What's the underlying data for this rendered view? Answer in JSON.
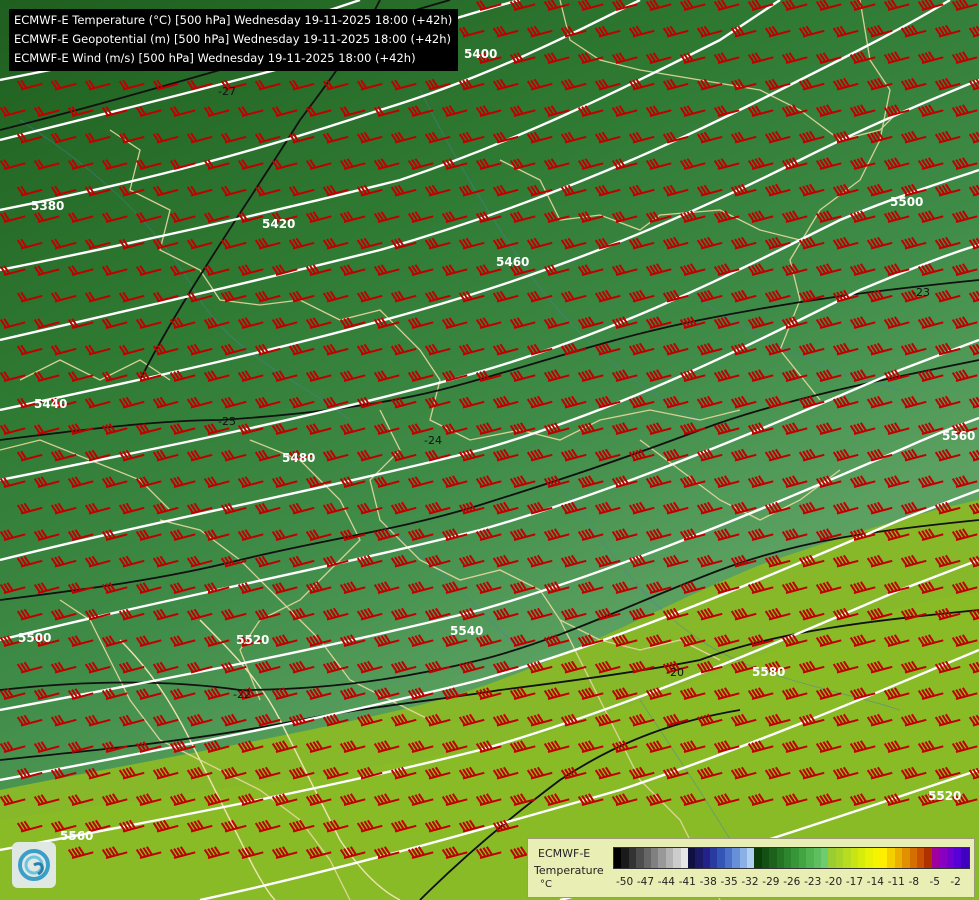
{
  "titles": [
    "ECMWF-E Temperature (°C) [500 hPa] Wednesday 19-11-2025 18:00 (+42h)",
    "ECMWF-E Geopotential (m) [500 hPa] Wednesday 19-11-2025 18:00 (+42h)",
    "ECMWF-E Wind (m/s) [500 hPa] Wednesday 19-11-2025 18:00 (+42h)"
  ],
  "geopotential_labels": [
    "5400",
    "5380",
    "5420",
    "5460",
    "5440",
    "5480",
    "5500",
    "5520",
    "5540",
    "5560",
    "5580",
    "5560",
    "5520",
    "5500"
  ],
  "temperature_labels": [
    "-27",
    "-25",
    "-24",
    "-23",
    "-22",
    "-20"
  ],
  "legend": {
    "title": "ECMWF-E",
    "variable": "Temperature",
    "unit": "°C",
    "ticks": [
      "-50",
      "-47",
      "-44",
      "-41",
      "-38",
      "-35",
      "-32",
      "-29",
      "-26",
      "-23",
      "-20",
      "-17",
      "-14",
      "-11",
      "-8",
      "-5",
      "-2"
    ],
    "colors": [
      "#000000",
      "#1a1a1a",
      "#333333",
      "#4d4d4d",
      "#666666",
      "#808080",
      "#999999",
      "#b3b3b3",
      "#cccccc",
      "#e6e6e6",
      "#101040",
      "#1a1a66",
      "#22228a",
      "#2a3aa0",
      "#3355b5",
      "#4a70c8",
      "#6690d8",
      "#8ab0e6",
      "#b0d0f2",
      "#0b3d0b",
      "#145014",
      "#1c621c",
      "#247424",
      "#2d852d",
      "#379637",
      "#42a542",
      "#4fb34f",
      "#5ebf5e",
      "#6fcb6f",
      "#9acd32",
      "#a8d42a",
      "#b8dc20",
      "#c8e416",
      "#d8ec0c",
      "#e8f205",
      "#f5f500",
      "#ffee00",
      "#f5d000",
      "#ebb000",
      "#e09000",
      "#d57000",
      "#c85000",
      "#b03000",
      "#a000a0",
      "#8a00c0",
      "#7000d0",
      "#5800d8",
      "#4000c0"
    ]
  },
  "logo_name": "ecmwf-logo"
}
